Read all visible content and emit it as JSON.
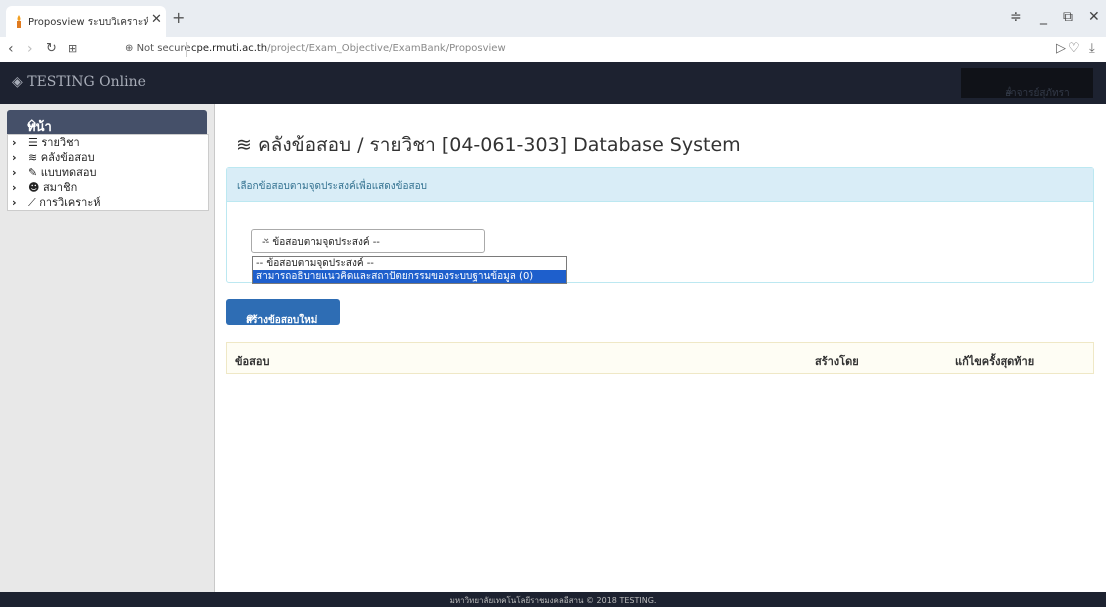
{
  "browser": {
    "tab_title": "Proposview ระบบวิเคราะห์ม...",
    "tab_close": "✕",
    "new_tab": "+",
    "security": "Not secure",
    "url_domain": "cpe.rmuti.ac.th",
    "url_path": "/project/Exam_Objective/ExamBank/Proposview"
  },
  "navbar": {
    "brand": "TESTING Online",
    "user_label": "อาจารย์สุภัทรา"
  },
  "sidebar": {
    "home": "หน้าหลัก",
    "items": [
      {
        "label": "รายวิชา"
      },
      {
        "label": "คลังข้อสอบ"
      },
      {
        "label": "แบบทดสอบ"
      },
      {
        "label": "สมาชิก"
      },
      {
        "label": "การวิเคราะห์"
      }
    ]
  },
  "main": {
    "title": "คลังข้อสอบ / รายวิชา [04-061-303] Database System",
    "panel_heading": "เลือกข้อสอบตามจุดประสงค์เพื่อแสดงข้อสอบ",
    "select": {
      "value": "-- ข้อสอบตามจุดประสงค์ --",
      "options": [
        "-- ข้อสอบตามจุดประสงค์ --",
        "สามารถอธิบายแนวคิดและสถาปัตยกรรมของระบบฐานข้อมูล (0)"
      ]
    },
    "new_button": "สร้างข้อสอบใหม่",
    "table_headers": [
      "ข้อสอบ",
      "สร้างโดย",
      "แก้ไขครั้งสุดท้าย"
    ]
  },
  "footer": {
    "text": "มหาวิทยาลัยเทคโนโลยีราชมงคลอีสาน © 2018 TESTING."
  },
  "colors": {
    "navbar_bg": "#1d2230",
    "sidebar_home_bg": "#455069",
    "panel_heading_bg": "#d9edf7",
    "primary_button": "#2e6db4",
    "selected_option": "#1e5fcc"
  }
}
